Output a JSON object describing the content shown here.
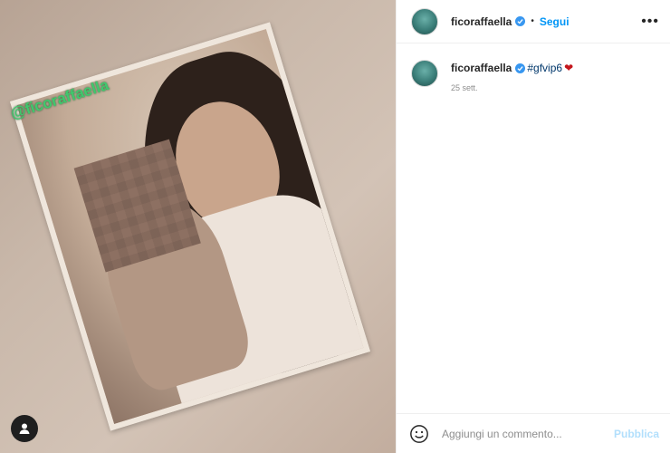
{
  "post": {
    "media_tag": "@ficoraffaella"
  },
  "header": {
    "username": "ficoraffaella",
    "separator": "•",
    "follow_label": "Segui",
    "more_label": "•••"
  },
  "caption": {
    "username": "ficoraffaella",
    "hashtag": "#gfvip6",
    "emoji": "❤",
    "timestamp": "25 sett."
  },
  "composer": {
    "placeholder": "Aggiungi un commento...",
    "publish_label": "Pubblica"
  },
  "icons": {
    "verified": "verified-badge-icon",
    "emoji": "smiley-icon",
    "profile": "user-icon",
    "more": "ellipsis-icon"
  },
  "colors": {
    "link_blue": "#0095f6",
    "verified_blue": "#3897f0",
    "tag_green": "#41c76d",
    "publish_disabled": "#b2dffc"
  }
}
